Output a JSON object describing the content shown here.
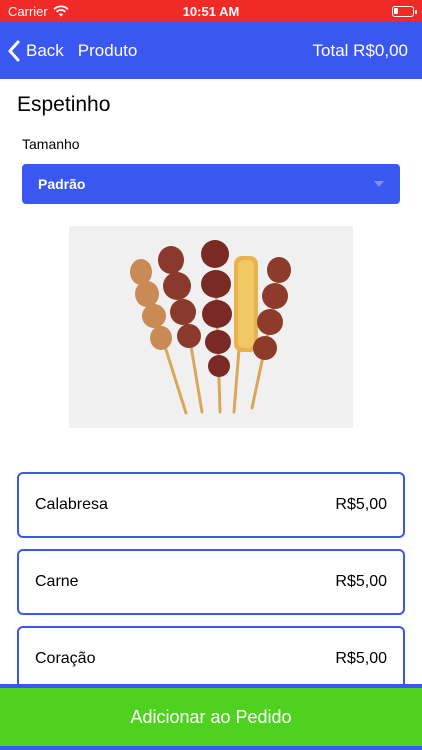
{
  "status": {
    "carrier": "Carrier",
    "time": "10:51 AM"
  },
  "nav": {
    "back_label": "Back",
    "title": "Produto",
    "total": "Total R$0,00"
  },
  "product": {
    "name": "Espetinho",
    "size_label": "Tamanho",
    "size_selected": "Padrão"
  },
  "items": [
    {
      "name": "Calabresa",
      "price": "R$5,00"
    },
    {
      "name": "Carne",
      "price": "R$5,00"
    },
    {
      "name": "Coração",
      "price": "R$5,00"
    }
  ],
  "actions": {
    "add_label": "Adicionar ao Pedido"
  },
  "colors": {
    "accent": "#3a57f2",
    "confirm": "#4fd11f",
    "status_bar": "#ef2a27"
  }
}
